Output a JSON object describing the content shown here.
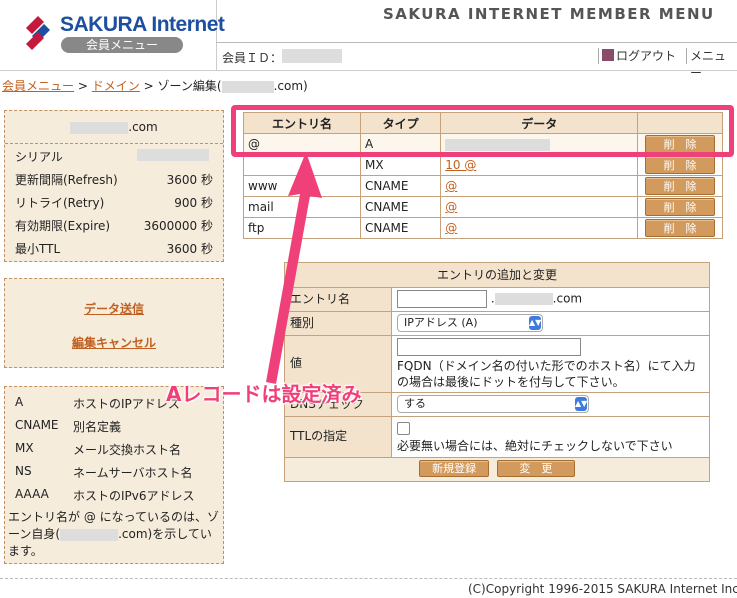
{
  "header": {
    "logo_text": "SAKURA Internet",
    "logo_sub": "会員メニュー",
    "menu_title": "SAKURA INTERNET MEMBER MENU",
    "member_id_label": "会員ＩＤ：",
    "logout": "ログアウト",
    "menu": "メニュー"
  },
  "breadcrumb": {
    "home": "会員メニュー",
    "sep1": ">",
    "domain": "ドメイン",
    "sep2": ">",
    "current_prefix": "ゾーン編集(",
    "current_suffix": ".com)"
  },
  "domain_panel": {
    "domain_suffix": ".com",
    "rows": [
      {
        "label": "シリアル",
        "value": ""
      },
      {
        "label": "更新間隔(Refresh)",
        "value": "3600 秒"
      },
      {
        "label": "リトライ(Retry)",
        "value": "900 秒"
      },
      {
        "label": "有効期限(Expire)",
        "value": "3600000 秒"
      },
      {
        "label": "最小TTL",
        "value": "3600 秒"
      }
    ]
  },
  "actions": {
    "send": "データ送信",
    "cancel": "編集キャンセル"
  },
  "legend": {
    "rows": [
      {
        "type": "A",
        "desc": "ホストのIPアドレス"
      },
      {
        "type": "CNAME",
        "desc": "別名定義"
      },
      {
        "type": "MX",
        "desc": "メール交換ホスト名"
      },
      {
        "type": "NS",
        "desc": "ネームサーバホスト名"
      },
      {
        "type": "AAAA",
        "desc": "ホストのIPv6アドレス"
      }
    ],
    "note_prefix": "エントリ名が @ になっているのは、ゾーン自身(",
    "note_suffix": ".com)を示しています。"
  },
  "records": {
    "headers": [
      "エントリ名",
      "タイプ",
      "データ",
      ""
    ],
    "rows": [
      {
        "name": "@",
        "type": "A",
        "data": ""
      },
      {
        "name": "",
        "type": "MX",
        "data": "10 @"
      },
      {
        "name": "www",
        "type": "CNAME",
        "data": "@"
      },
      {
        "name": "mail",
        "type": "CNAME",
        "data": "@"
      },
      {
        "name": "ftp",
        "type": "CNAME",
        "data": "@"
      }
    ],
    "delete_label": "削　除"
  },
  "form": {
    "title": "エントリの追加と変更",
    "entry_label": "エントリ名",
    "entry_suffix": ".com",
    "type_label": "種別",
    "type_value": "IPアドレス (A)",
    "value_label": "値",
    "value_help": "FQDN（ドメイン名の付いた形でのホスト名）にて入力の場合は最後にドットを付与して下さい。",
    "dns_label": "DNSチェック",
    "dns_value": "する",
    "ttl_label": "TTLの指定",
    "ttl_help": "必要無い場合には、絶対にチェックしないで下さい",
    "new_button": "新規登録",
    "change_button": "変　更"
  },
  "annotation": {
    "text": "Aレコードは設定済み",
    "color": "#f0407a"
  },
  "footer": {
    "copyright": "(C)Copyright 1996-2015 SAKURA Internet Inc."
  }
}
